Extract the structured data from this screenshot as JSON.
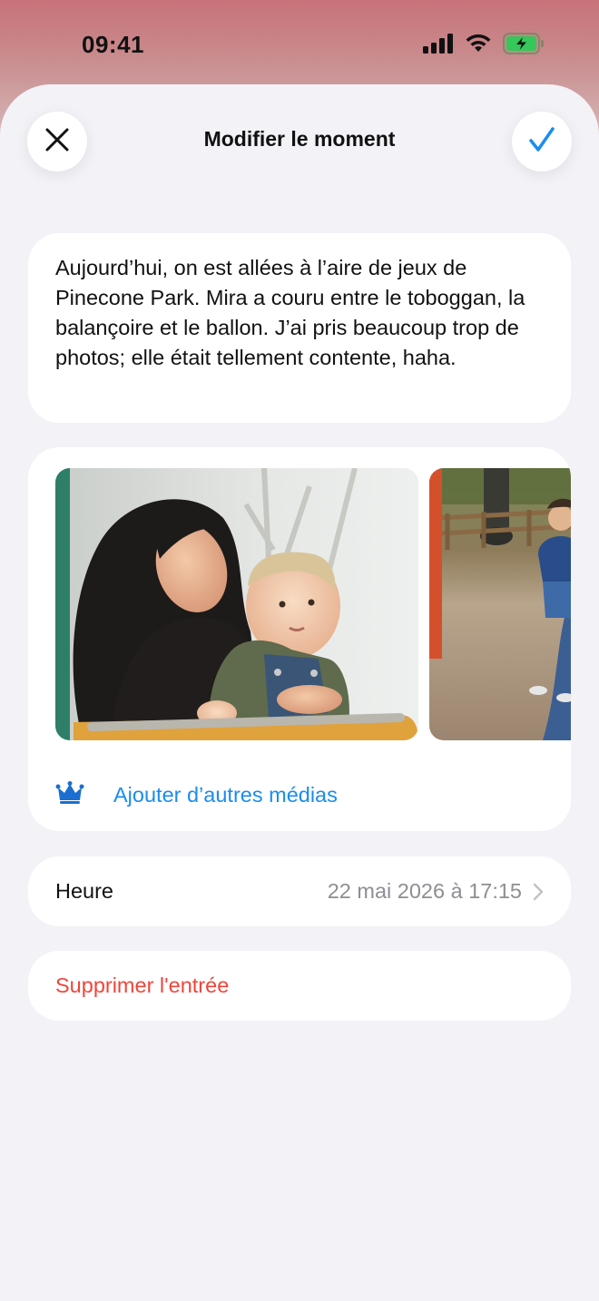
{
  "status_bar": {
    "time": "09:41",
    "icons": [
      "cellular-signal-icon",
      "wifi-icon",
      "battery-charging-icon"
    ]
  },
  "header": {
    "title": "Modifier le moment",
    "close_icon": "close-icon",
    "done_icon": "checkmark-icon"
  },
  "note": {
    "text": "Aujourd’hui, on est allées à l’aire de jeux de Pinecone Park. Mira a couru entre le toboggan, la balançoire et le ballon. J’ai pris beaucoup trop de photos; elle était tellement contente, haha."
  },
  "media": {
    "photos": [
      "photo-mother-and-baby",
      "photo-playground-walk"
    ],
    "add_icon": "crown-icon",
    "add_label": "Ajouter d’autres médias"
  },
  "time_row": {
    "label": "Heure",
    "value": "22 mai 2026 à 17:15"
  },
  "delete_row": {
    "label": "Supprimer l'entrée"
  },
  "colors": {
    "accent": "#1a8cf0",
    "destructive": "#f2443a",
    "background": "#f2f2f7",
    "header_tint": "#c8727a",
    "battery_green": "#34c759"
  }
}
